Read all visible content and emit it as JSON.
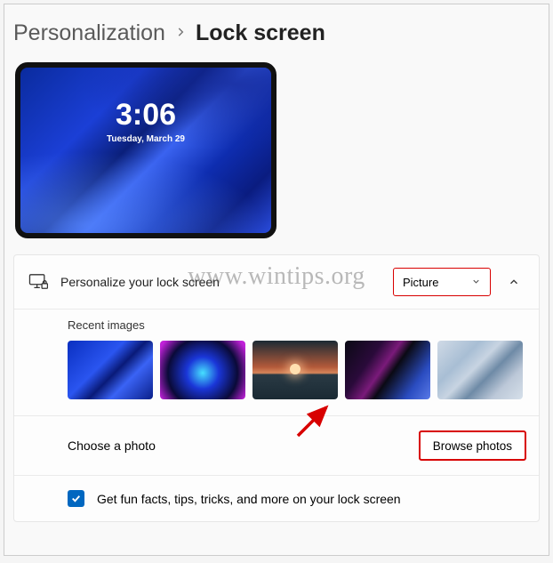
{
  "breadcrumb": {
    "parent": "Personalization",
    "current": "Lock screen"
  },
  "preview": {
    "time": "3:06",
    "date": "Tuesday, March 29"
  },
  "personalize": {
    "label": "Personalize your lock screen",
    "dropdown_value": "Picture"
  },
  "recent": {
    "title": "Recent images"
  },
  "choose": {
    "label": "Choose a photo",
    "button": "Browse photos"
  },
  "funfacts": {
    "label": "Get fun facts, tips, tricks, and more on your lock screen",
    "checked": true
  },
  "watermark": "www.wintips.org"
}
